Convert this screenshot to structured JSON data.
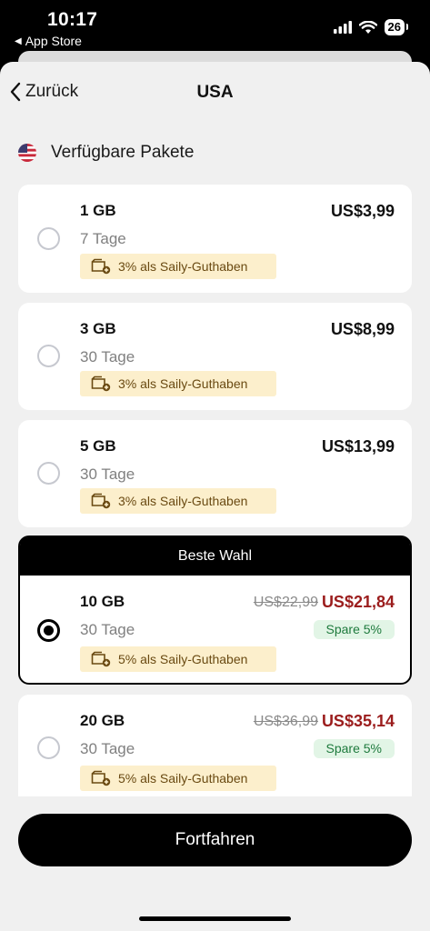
{
  "status_bar": {
    "time": "10:17",
    "back_app": "App Store",
    "battery": "26"
  },
  "nav": {
    "back_label": "Zurück",
    "title": "USA"
  },
  "section": {
    "title": "Verfügbare Pakete"
  },
  "plans": [
    {
      "size": "1 GB",
      "days": "7 Tage",
      "price": "US$3,99",
      "credit": "3% als Saily-Guthaben",
      "selected": false
    },
    {
      "size": "3 GB",
      "days": "30 Tage",
      "price": "US$8,99",
      "credit": "3% als Saily-Guthaben",
      "selected": false
    },
    {
      "size": "5 GB",
      "days": "30 Tage",
      "price": "US$13,99",
      "credit": "3% als Saily-Guthaben",
      "selected": false
    },
    {
      "banner": "Beste Wahl",
      "size": "10 GB",
      "days": "30 Tage",
      "old_price": "US$22,99",
      "price": "US$21,84",
      "save": "Spare 5%",
      "credit": "5% als Saily-Guthaben",
      "selected": true
    },
    {
      "size": "20 GB",
      "days": "30 Tage",
      "old_price": "US$36,99",
      "price": "US$35,14",
      "save": "Spare 5%",
      "credit": "5% als Saily-Guthaben",
      "selected": false
    }
  ],
  "continue_label": "Fortfahren",
  "colors": {
    "sale": "#9b1d1d",
    "save_bg": "#e2f5e6",
    "save_text": "#1e7a3d",
    "credit_bg": "#fcefcc"
  }
}
